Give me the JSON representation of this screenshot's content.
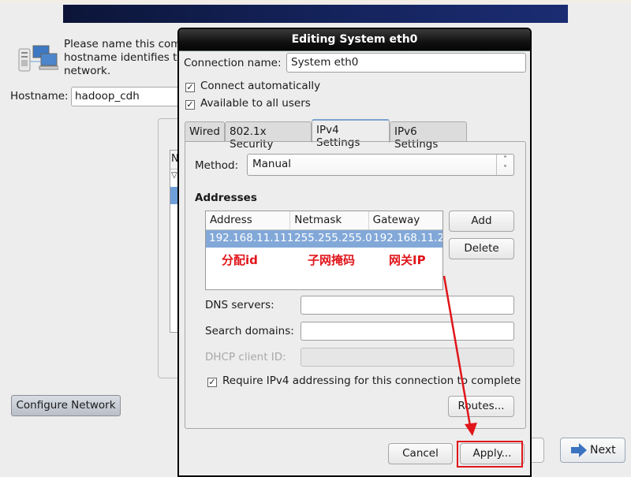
{
  "background": {
    "intro_text": [
      "Please name this com",
      "hostname identifies th",
      "network."
    ],
    "hostname_label": "Hostname:",
    "hostname_value": "hadoop_cdh",
    "list_header_partial": "N",
    "configure_network_label": "Configure Network",
    "next_label": "Next"
  },
  "dialog": {
    "title": "Editing System eth0",
    "connection_name_label": "Connection name:",
    "connection_name_value": "System eth0",
    "connect_automatically_label": "Connect automatically",
    "connect_automatically_checked": true,
    "available_all_users_label": "Available to all users",
    "available_all_users_checked": true,
    "tabs": [
      {
        "label": "Wired",
        "active": false
      },
      {
        "label": "802.1x Security",
        "active": false
      },
      {
        "label": "IPv4 Settings",
        "active": true
      },
      {
        "label": "IPv6 Settings",
        "active": false
      }
    ],
    "method_label": "Method:",
    "method_value": "Manual",
    "addresses_heading": "Addresses",
    "addresses_columns": [
      "Address",
      "Netmask",
      "Gateway"
    ],
    "addresses_rows": [
      [
        "192.168.11.111",
        "255.255.255.0",
        "192.168.11.2"
      ]
    ],
    "add_label": "Add",
    "delete_label": "Delete",
    "dns_label": "DNS servers:",
    "dns_value": "",
    "search_domains_label": "Search domains:",
    "search_domains_value": "",
    "dhcp_client_id_label": "DHCP client ID:",
    "dhcp_client_id_value": "",
    "require_ipv4_label": "Require IPv4 addressing for this connection to complete",
    "require_ipv4_checked": true,
    "routes_label": "Routes...",
    "cancel_label": "Cancel",
    "apply_label": "Apply..."
  },
  "annotations": {
    "address_note": "分配id",
    "netmask_note": "子网掩码",
    "gateway_note": "网关IP",
    "color": "#e0161b"
  }
}
